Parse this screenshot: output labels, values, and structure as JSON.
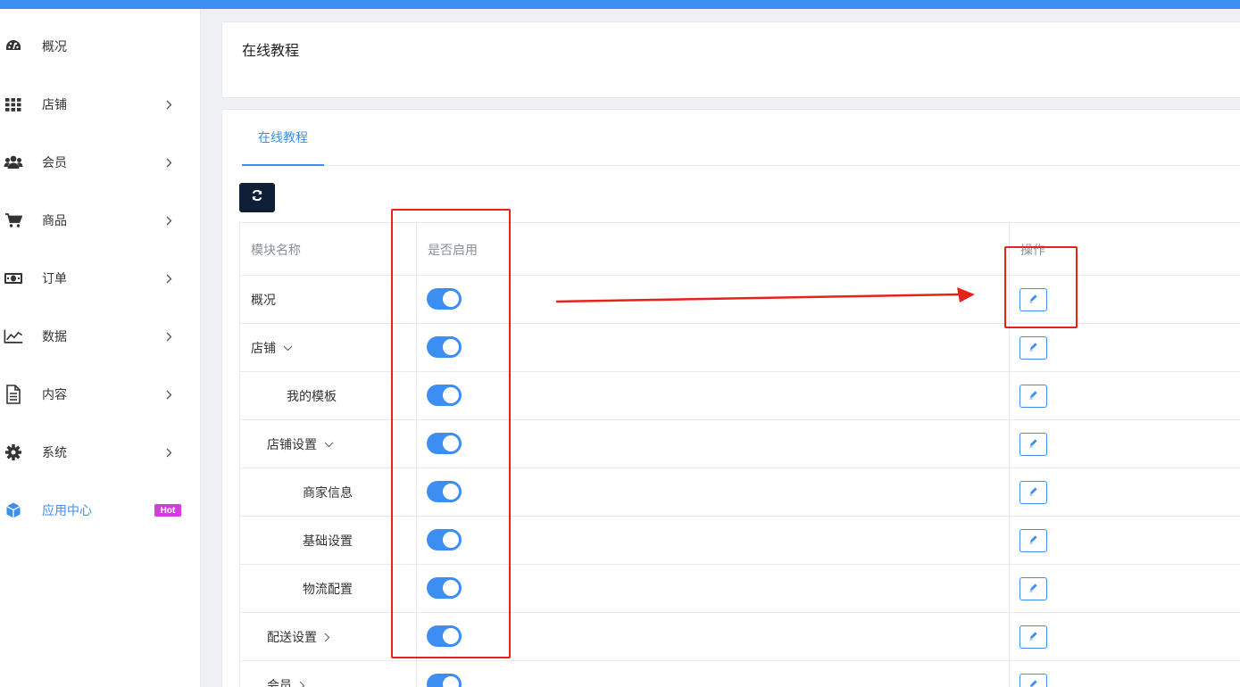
{
  "sidebar": {
    "items": [
      {
        "label": "概况",
        "icon": "dashboard-icon",
        "has_arrow": false
      },
      {
        "label": "店铺",
        "icon": "grid-icon",
        "has_arrow": true
      },
      {
        "label": "会员",
        "icon": "users-icon",
        "has_arrow": true
      },
      {
        "label": "商品",
        "icon": "cart-icon",
        "has_arrow": true
      },
      {
        "label": "订单",
        "icon": "money-icon",
        "has_arrow": true
      },
      {
        "label": "数据",
        "icon": "chart-icon",
        "has_arrow": true
      },
      {
        "label": "内容",
        "icon": "document-icon",
        "has_arrow": true
      },
      {
        "label": "系统",
        "icon": "gear-icon",
        "has_arrow": true
      },
      {
        "label": "应用中心",
        "icon": "cube-icon",
        "has_arrow": false,
        "active": true,
        "badge": "Hot"
      }
    ]
  },
  "header": {
    "title": "在线教程"
  },
  "tabs": [
    {
      "label": "在线教程",
      "active": true
    }
  ],
  "table": {
    "columns": {
      "name": "模块名称",
      "enabled": "是否启用",
      "action": "操作"
    },
    "rows": [
      {
        "name": "概况",
        "level": 0,
        "caret": "",
        "enabled": true
      },
      {
        "name": "店铺",
        "level": 0,
        "caret": "down",
        "enabled": true
      },
      {
        "name": "我的模板",
        "level": 2,
        "caret": "",
        "enabled": true
      },
      {
        "name": "店铺设置",
        "level": 1,
        "caret": "down",
        "enabled": true
      },
      {
        "name": "商家信息",
        "level": 3,
        "caret": "",
        "enabled": true
      },
      {
        "name": "基础设置",
        "level": 3,
        "caret": "",
        "enabled": true
      },
      {
        "name": "物流配置",
        "level": 3,
        "caret": "",
        "enabled": true
      },
      {
        "name": "配送设置",
        "level": 1,
        "caret": "right",
        "enabled": true
      },
      {
        "name": "会员",
        "level": 1,
        "caret": "right",
        "enabled": true
      }
    ]
  },
  "colors": {
    "accent": "#3d8ef2",
    "dark_button": "#0f1f38",
    "hot_badge": "#d63ce0",
    "annotation": "#e8221a"
  }
}
